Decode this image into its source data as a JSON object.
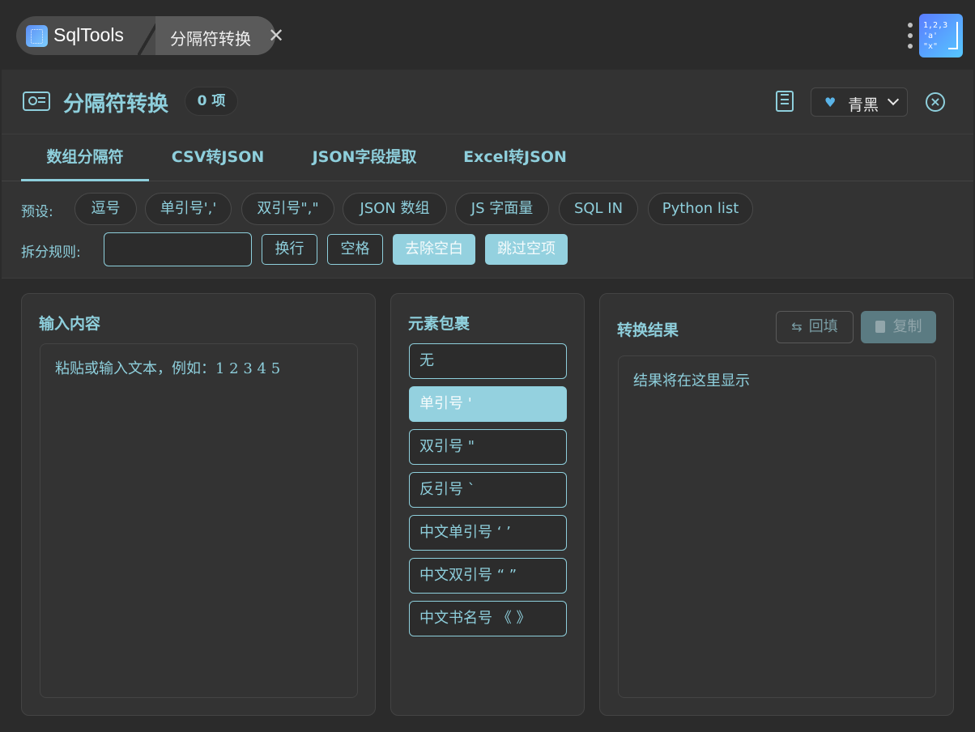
{
  "titlebar": {
    "app_name": "SqlTools",
    "tab_label": "分隔符转换",
    "tab_close": "✕",
    "corner_logo": [
      "1,2,3",
      "'a'",
      "\"x\""
    ]
  },
  "header": {
    "title": "分隔符转换",
    "count_badge": "0 项",
    "theme": {
      "selected": "青黑",
      "icon": "heart-icon"
    }
  },
  "tabs": [
    {
      "label": "数组分隔符",
      "active": true
    },
    {
      "label": "CSV转JSON",
      "active": false
    },
    {
      "label": "JSON字段提取",
      "active": false
    },
    {
      "label": "Excel转JSON",
      "active": false
    }
  ],
  "presets": {
    "label": "预设:",
    "items": [
      "逗号",
      "单引号','",
      "双引号\",\"",
      "JSON 数组",
      "JS 字面量",
      "SQL IN",
      "Python list"
    ]
  },
  "split_rules": {
    "label": "拆分规则:",
    "input_value": "",
    "buttons": [
      {
        "label": "换行",
        "active": false
      },
      {
        "label": "空格",
        "active": false
      },
      {
        "label": "去除空白",
        "active": true
      },
      {
        "label": "跳过空项",
        "active": true
      }
    ]
  },
  "input_panel": {
    "title": "输入内容",
    "placeholder": "粘贴或输入文本，例如：1 2 3 4 5"
  },
  "wrap_panel": {
    "title": "元素包裹",
    "options": [
      {
        "label": "无",
        "active": false
      },
      {
        "label": "单引号 '",
        "active": true
      },
      {
        "label": "双引号 \"",
        "active": false
      },
      {
        "label": "反引号 `",
        "active": false
      },
      {
        "label": "中文单引号 ‘ ’",
        "active": false
      },
      {
        "label": "中文双引号 “ ”",
        "active": false
      },
      {
        "label": "中文书名号 《 》",
        "active": false
      }
    ]
  },
  "result_panel": {
    "title": "转换结果",
    "refill_label": "回填",
    "copy_label": "复制",
    "placeholder": "结果将在这里显示"
  },
  "colors": {
    "accent": "#8ecfdc",
    "accent_fill": "#94d1df",
    "background": "#2b2b2b",
    "panel": "#333333"
  }
}
